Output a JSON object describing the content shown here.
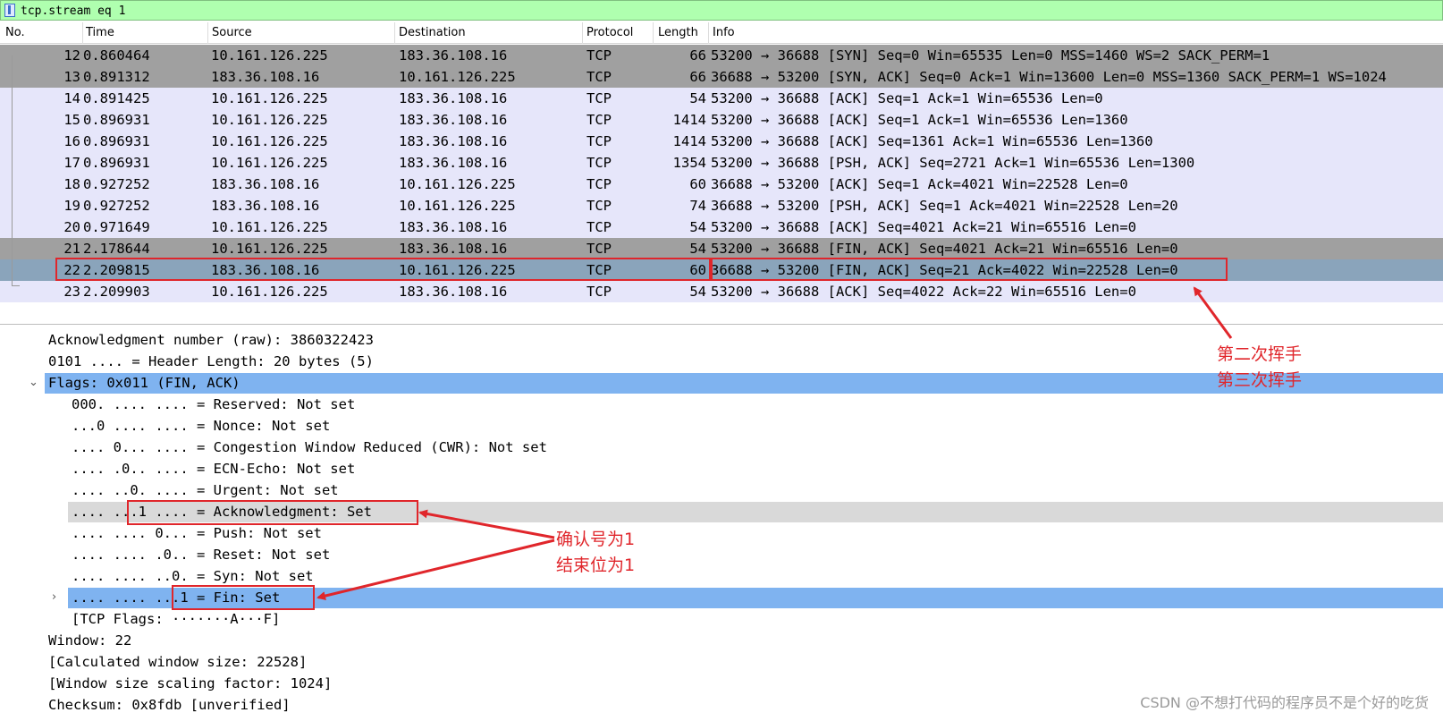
{
  "filter": {
    "value": "tcp.stream eq 1",
    "icon": "bookmark-icon"
  },
  "columns": [
    "No.",
    "Time",
    "Source",
    "Destination",
    "Protocol",
    "Length",
    "Info"
  ],
  "packets": [
    {
      "no": "12",
      "time": "0.860464",
      "src": "10.161.126.225",
      "dst": "183.36.108.16",
      "proto": "TCP",
      "len": "66",
      "info": "53200 → 36688 [SYN] Seq=0 Win=65535 Len=0 MSS=1460 WS=2 SACK_PERM=1",
      "style": "gray"
    },
    {
      "no": "13",
      "time": "0.891312",
      "src": "183.36.108.16",
      "dst": "10.161.126.225",
      "proto": "TCP",
      "len": "66",
      "info": "36688 → 53200 [SYN, ACK] Seq=0 Ack=1 Win=13600 Len=0 MSS=1360 SACK_PERM=1 WS=1024",
      "style": "gray"
    },
    {
      "no": "14",
      "time": "0.891425",
      "src": "10.161.126.225",
      "dst": "183.36.108.16",
      "proto": "TCP",
      "len": "54",
      "info": "53200 → 36688 [ACK] Seq=1 Ack=1 Win=65536 Len=0",
      "style": "lav"
    },
    {
      "no": "15",
      "time": "0.896931",
      "src": "10.161.126.225",
      "dst": "183.36.108.16",
      "proto": "TCP",
      "len": "1414",
      "info": "53200 → 36688 [ACK] Seq=1 Ack=1 Win=65536 Len=1360",
      "style": "lav"
    },
    {
      "no": "16",
      "time": "0.896931",
      "src": "10.161.126.225",
      "dst": "183.36.108.16",
      "proto": "TCP",
      "len": "1414",
      "info": "53200 → 36688 [ACK] Seq=1361 Ack=1 Win=65536 Len=1360",
      "style": "lav"
    },
    {
      "no": "17",
      "time": "0.896931",
      "src": "10.161.126.225",
      "dst": "183.36.108.16",
      "proto": "TCP",
      "len": "1354",
      "info": "53200 → 36688 [PSH, ACK] Seq=2721 Ack=1 Win=65536 Len=1300",
      "style": "lav"
    },
    {
      "no": "18",
      "time": "0.927252",
      "src": "183.36.108.16",
      "dst": "10.161.126.225",
      "proto": "TCP",
      "len": "60",
      "info": "36688 → 53200 [ACK] Seq=1 Ack=4021 Win=22528 Len=0",
      "style": "lav"
    },
    {
      "no": "19",
      "time": "0.927252",
      "src": "183.36.108.16",
      "dst": "10.161.126.225",
      "proto": "TCP",
      "len": "74",
      "info": "36688 → 53200 [PSH, ACK] Seq=1 Ack=4021 Win=22528 Len=20",
      "style": "lav"
    },
    {
      "no": "20",
      "time": "0.971649",
      "src": "10.161.126.225",
      "dst": "183.36.108.16",
      "proto": "TCP",
      "len": "54",
      "info": "53200 → 36688 [ACK] Seq=4021 Ack=21 Win=65516 Len=0",
      "style": "lav"
    },
    {
      "no": "21",
      "time": "2.178644",
      "src": "10.161.126.225",
      "dst": "183.36.108.16",
      "proto": "TCP",
      "len": "54",
      "info": "53200 → 36688 [FIN, ACK] Seq=4021 Ack=21 Win=65516 Len=0",
      "style": "gray"
    },
    {
      "no": "22",
      "time": "2.209815",
      "src": "183.36.108.16",
      "dst": "10.161.126.225",
      "proto": "TCP",
      "len": "60",
      "info": "36688 → 53200 [FIN, ACK] Seq=21 Ack=4022 Win=22528 Len=0",
      "style": "sel"
    },
    {
      "no": "23",
      "time": "2.209903",
      "src": "10.161.126.225",
      "dst": "183.36.108.16",
      "proto": "TCP",
      "len": "54",
      "info": "53200 → 36688 [ACK] Seq=4022 Ack=22 Win=65516 Len=0",
      "style": "lav"
    }
  ],
  "details": [
    {
      "text": "Acknowledgment number (raw): 3860322423",
      "indent": 0,
      "hl": "",
      "expander": ""
    },
    {
      "text": "0101 .... = Header Length: 20 bytes (5)",
      "indent": 0,
      "hl": "",
      "expander": ""
    },
    {
      "text": "Flags: 0x011 (FIN, ACK)",
      "indent": 0,
      "hl": "blue",
      "expander": "⌄"
    },
    {
      "text": "000. .... .... = Reserved: Not set",
      "indent": 1,
      "hl": "",
      "expander": ""
    },
    {
      "text": "...0 .... .... = Nonce: Not set",
      "indent": 1,
      "hl": "",
      "expander": ""
    },
    {
      "text": ".... 0... .... = Congestion Window Reduced (CWR): Not set",
      "indent": 1,
      "hl": "",
      "expander": ""
    },
    {
      "text": ".... .0.. .... = ECN-Echo: Not set",
      "indent": 1,
      "hl": "",
      "expander": ""
    },
    {
      "text": ".... ..0. .... = Urgent: Not set",
      "indent": 1,
      "hl": "",
      "expander": ""
    },
    {
      "text": ".... ...1 .... = Acknowledgment: Set",
      "indent": 1,
      "hl": "gray",
      "expander": ""
    },
    {
      "text": ".... .... 0... = Push: Not set",
      "indent": 1,
      "hl": "",
      "expander": ""
    },
    {
      "text": ".... .... .0.. = Reset: Not set",
      "indent": 1,
      "hl": "",
      "expander": ""
    },
    {
      "text": ".... .... ..0. = Syn: Not set",
      "indent": 1,
      "hl": "",
      "expander": ""
    },
    {
      "text": ".... .... ...1 = Fin: Set",
      "indent": 1,
      "hl": "blue",
      "expander": "›"
    },
    {
      "text": "[TCP Flags: ·······A···F]",
      "indent": 1,
      "hl": "",
      "expander": ""
    },
    {
      "text": "Window: 22",
      "indent": 0,
      "hl": "",
      "expander": ""
    },
    {
      "text": "[Calculated window size: 22528]",
      "indent": 0,
      "hl": "",
      "expander": ""
    },
    {
      "text": "[Window size scaling factor: 1024]",
      "indent": 0,
      "hl": "",
      "expander": ""
    },
    {
      "text": "Checksum: 0x8fdb [unverified]",
      "indent": 0,
      "hl": "",
      "expander": ""
    }
  ],
  "annotations": {
    "handshake_line1": "第二次挥手",
    "handshake_line2": "第三次挥手",
    "flags_line1": "确认号为1",
    "flags_line2": "结束位为1",
    "color": "#e0262b"
  },
  "watermark": "CSDN @不想打代码的程序员不是个好的吃货"
}
